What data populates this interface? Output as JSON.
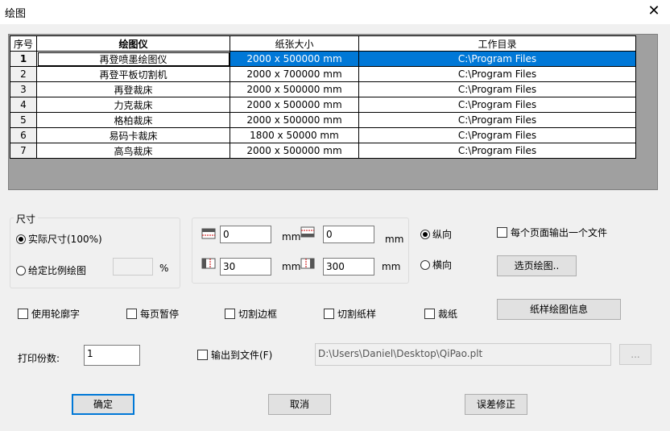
{
  "window": {
    "title": "绘图"
  },
  "table": {
    "headers": [
      "序号",
      "绘图仪",
      "纸张大小",
      "工作目录"
    ],
    "rows": [
      {
        "num": "1",
        "plotter": "再登喷墨绘图仪",
        "paper": "2000 x 500000 mm",
        "dir": "C:\\Program Files"
      },
      {
        "num": "2",
        "plotter": "再登平板切割机",
        "paper": "2000 x 700000 mm",
        "dir": "C:\\Program Files"
      },
      {
        "num": "3",
        "plotter": "再登裁床",
        "paper": "2000 x 500000 mm",
        "dir": "C:\\Program Files"
      },
      {
        "num": "4",
        "plotter": "力克裁床",
        "paper": "2000 x 500000 mm",
        "dir": "C:\\Program Files"
      },
      {
        "num": "5",
        "plotter": "格柏裁床",
        "paper": "2000 x 500000 mm",
        "dir": "C:\\Program Files"
      },
      {
        "num": "6",
        "plotter": "易码卡裁床",
        "paper": "1800 x 50000 mm",
        "dir": "C:\\Program Files"
      },
      {
        "num": "7",
        "plotter": "高鸟裁床",
        "paper": "2000 x 500000 mm",
        "dir": "C:\\Program Files"
      }
    ]
  },
  "size_group": {
    "legend": "尺寸",
    "actual_label": "实际尺寸(100%)",
    "scale_label": "给定比例绘图",
    "scale_value": "",
    "percent": "%"
  },
  "margins": {
    "top": "0",
    "bottom": "0",
    "left": "30",
    "right": "300",
    "unit": "mm"
  },
  "orientation": {
    "portrait": "纵向",
    "landscape": "横向"
  },
  "per_page_file": "每个页面输出一个文件",
  "select_page_button": "选页绘图..",
  "options": {
    "outline_font": "使用轮廓字",
    "pause_per_page": "每页暂停",
    "cut_border": "切割边框",
    "cut_sample": "切割纸样",
    "cut_paper": "裁纸"
  },
  "sample_info_button": "纸样绘图信息",
  "copies": {
    "label": "打印份数:",
    "value": "1"
  },
  "output_file": {
    "label": "输出到文件(F)",
    "path": "D:\\Users\\Daniel\\Desktop\\QiPao.plt",
    "browse": "..."
  },
  "buttons": {
    "ok": "确定",
    "cancel": "取消",
    "error_fix": "误差修正"
  },
  "colors": {
    "selection": "#0078d7",
    "grid_bg": "#a0a0a0",
    "window_bg": "#f0f0f0"
  },
  "icons": {
    "close": "close-icon",
    "top_margin": "top-margin-icon",
    "bottom_margin": "bottom-margin-icon",
    "left_margin": "left-margin-icon",
    "right_margin": "right-margin-icon"
  }
}
